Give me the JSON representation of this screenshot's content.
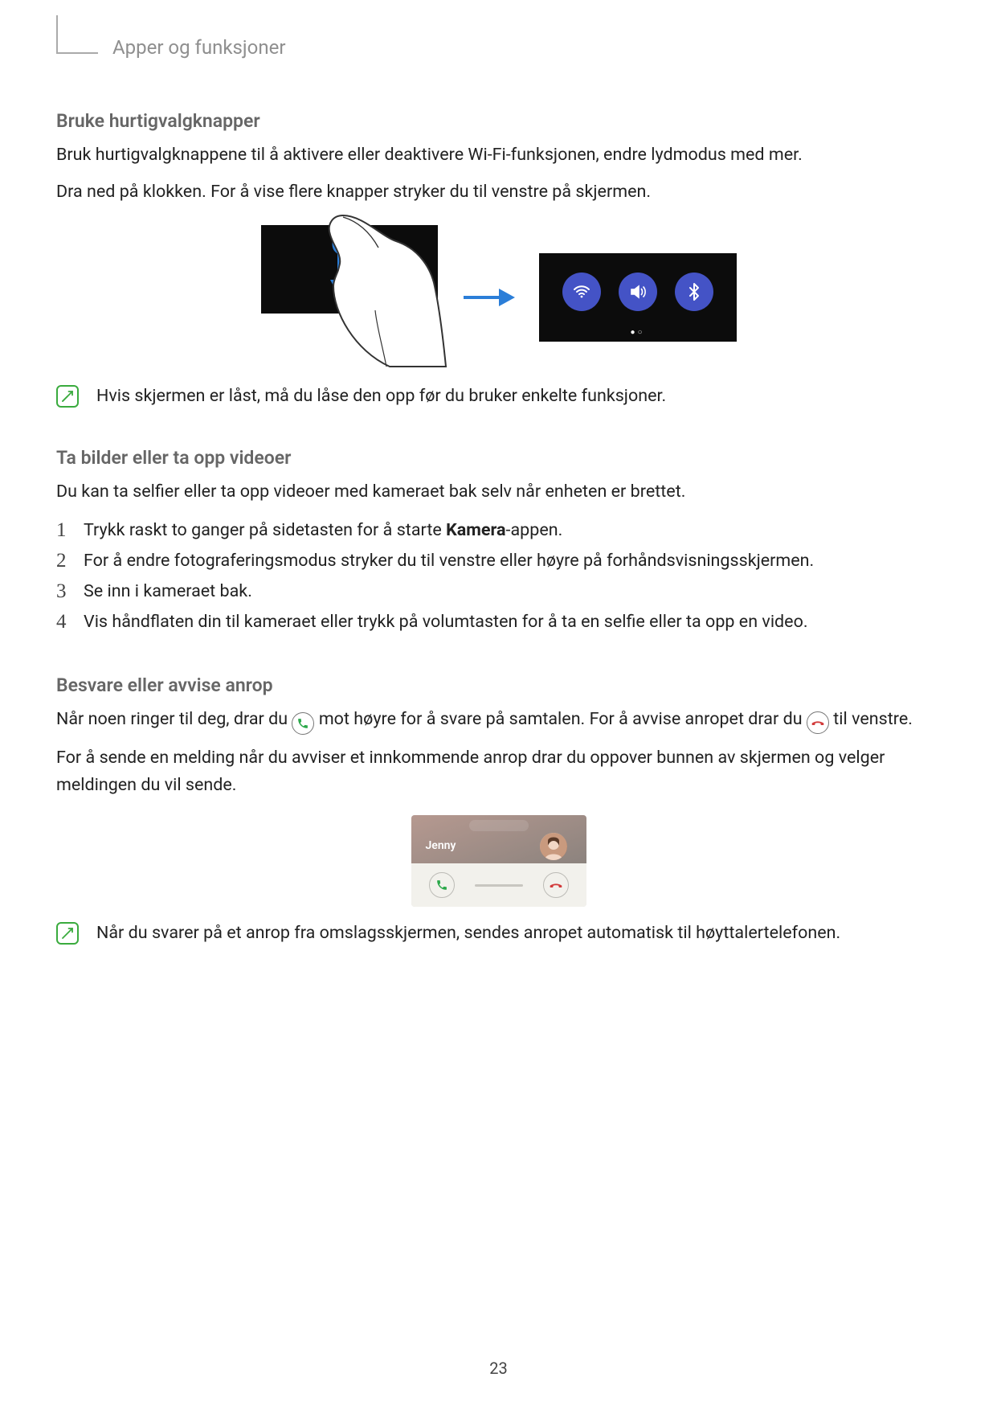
{
  "header": {
    "title": "Apper og funksjoner"
  },
  "section1": {
    "heading": "Bruke hurtigvalgknapper",
    "para1": "Bruk hurtigvalgknappene til å aktivere eller deaktivere Wi-Fi-funksjonen, endre lydmodus med mer.",
    "para2": "Dra ned på klokken. For å vise flere knapper stryker du til venstre på skjermen."
  },
  "note1": {
    "text": "Hvis skjermen er låst, må du låse den opp før du bruker enkelte funksjoner."
  },
  "section2": {
    "heading": "Ta bilder eller ta opp videoer",
    "intro": "Du kan ta selfier eller ta opp videoer med kameraet bak selv når enheten er brettet.",
    "steps": {
      "s1a": "Trykk raskt to ganger på sidetasten for å starte ",
      "s1bold": "Kamera",
      "s1b": "-appen.",
      "s2": "For å endre fotograferingsmodus stryker du til venstre eller høyre på forhåndsvisningsskjermen.",
      "s3": "Se inn i kameraet bak.",
      "s4": "Vis håndflaten din til kameraet eller trykk på volumtasten for å ta en selfie eller ta opp en video."
    }
  },
  "section3": {
    "heading": "Besvare eller avvise anrop",
    "p1a": "Når noen ringer til deg, drar du ",
    "p1b": " mot høyre for å svare på samtalen. For å avvise anropet drar du ",
    "p1c": " til venstre.",
    "p2": "For å sende en melding når du avviser et innkommende anrop drar du oppover bunnen av skjermen og velger meldingen du vil sende.",
    "caller_name": "Jenny"
  },
  "note2": {
    "text": "Når du svarer på et anrop fra omslagsskjermen, sendes anropet automatisk til høyttalertelefonen."
  },
  "page_number": "23"
}
